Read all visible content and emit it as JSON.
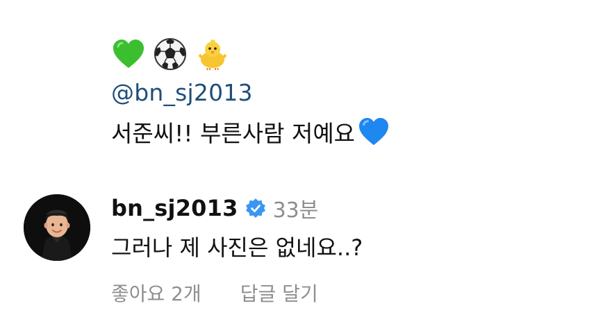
{
  "parent_comment": {
    "emojis": [
      "green-heart",
      "soccer-ball",
      "baby-chick"
    ],
    "mention": "@bn_sj2013",
    "text": "서준씨!! 부른사람 저예요",
    "trailing_emoji": "blue-heart"
  },
  "reply": {
    "username": "bn_sj2013",
    "verified": true,
    "time": "33분",
    "text": "그러나 제 사진은 없네요..?",
    "actions": {
      "like_count": "좋아요 2개",
      "reply_label": "답글 달기"
    }
  },
  "colors": {
    "mention": "#1f4e79",
    "verified_badge": "#3897f0",
    "meta_gray": "#8e8e8e",
    "green_heart": "#3bbf2f",
    "blue_heart": "#1e87f0"
  }
}
